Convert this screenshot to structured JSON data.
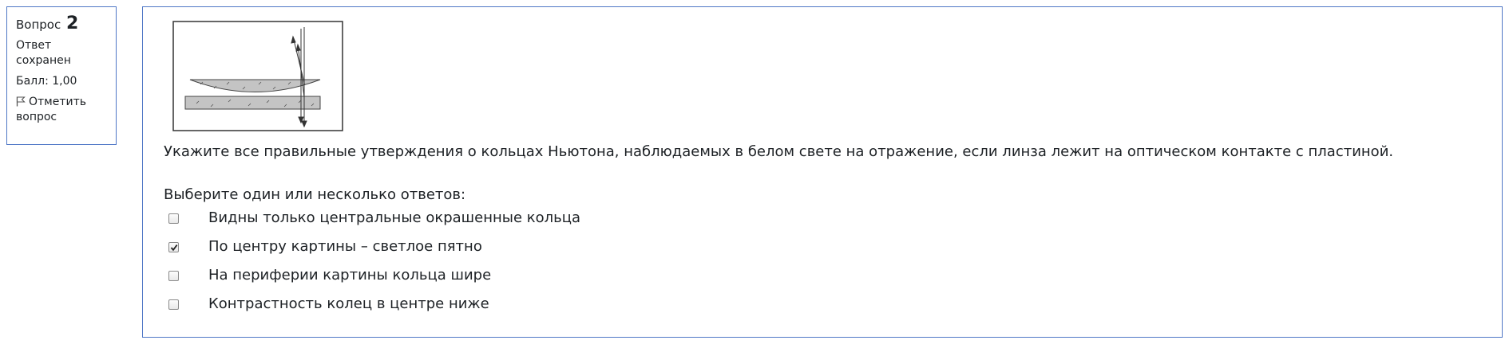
{
  "question_info": {
    "label": "Вопрос",
    "number": "2",
    "state": "Ответ сохранен",
    "grade": "Балл: 1,00",
    "flag_label": "Отметить вопрос",
    "flag_icon": "flag-icon"
  },
  "question": {
    "figure_icon": "newton-rings-diagram",
    "text": "Укажите все правильные утверждения о кольцах Ньютона, наблюдаемых в белом свете на отражение, если линза лежит на оптическом контакте с пластиной.",
    "prompt": "Выберите один или несколько ответов:"
  },
  "answers": [
    {
      "label": "Видны только центральные окрашенные кольца",
      "checked": false
    },
    {
      "label": "По центру картины – светлое пятно",
      "checked": true
    },
    {
      "label": "На периферии картины кольца шире",
      "checked": false
    },
    {
      "label": "Контрастность колец в центре ниже",
      "checked": false
    }
  ],
  "colors": {
    "border": "#4f77c6",
    "text": "#1d2125"
  }
}
